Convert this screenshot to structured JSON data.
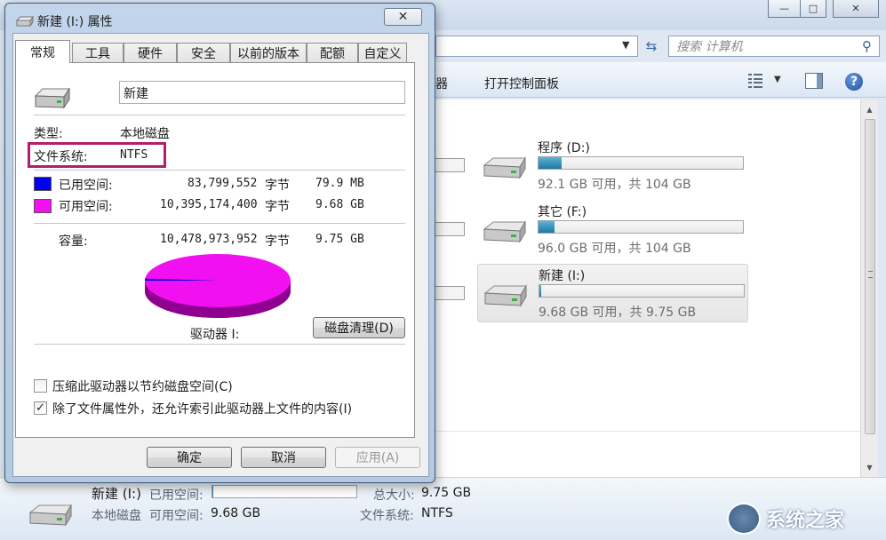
{
  "dialog": {
    "title": "新建 (I:) 属性",
    "close_glyph": "✕",
    "tabs": [
      {
        "label": "常规",
        "active": true
      },
      {
        "label": "工具"
      },
      {
        "label": "硬件"
      },
      {
        "label": "安全"
      },
      {
        "label": "以前的版本"
      },
      {
        "label": "配额"
      },
      {
        "label": "自定义"
      }
    ],
    "volume_name": "新建",
    "type_label": "类型:",
    "type_value": "本地磁盘",
    "fs_label": "文件系统:",
    "fs_value": "NTFS",
    "used": {
      "label": "已用空间:",
      "bytes": "83,799,552",
      "unit": "字节",
      "size": "79.9 MB",
      "color": "#0000f0"
    },
    "free": {
      "label": "可用空间:",
      "bytes": "10,395,174,400",
      "unit": "字节",
      "size": "9.68 GB",
      "color": "#f010f0"
    },
    "capacity": {
      "label": "容量:",
      "bytes": "10,478,973,952",
      "unit": "字节",
      "size": "9.75 GB"
    },
    "used_fraction": 0.008,
    "drive_caption": "驱动器 I:",
    "cleanup_button": "磁盘清理(D)",
    "compress": {
      "label": "压缩此驱动器以节约磁盘空间(C)",
      "checked": false
    },
    "index": {
      "label": "除了文件属性外，还允许索引此驱动器上文件的内容(I)",
      "checked": true
    },
    "ok_button": "确定",
    "cancel_button": "取消",
    "apply_button": "应用(A)"
  },
  "explorer": {
    "search_placeholder": "搜索 计算机",
    "toolbar_fragment": "器",
    "control_panel": "打开控制面板",
    "window_controls": {
      "minimize": "—",
      "maximize": "□",
      "close": "✕"
    },
    "drives": [
      {
        "name": "程序 (D:)",
        "free_text": "92.1 GB 可用，共 104 GB",
        "used_fraction": 0.115
      },
      {
        "name": "其它 (F:)",
        "free_text": "96.0 GB 可用，共 104 GB",
        "used_fraction": 0.077
      },
      {
        "name": "新建 (I:)",
        "free_text": "9.68 GB 可用，共 9.75 GB",
        "used_fraction": 0.008,
        "selected": true
      }
    ]
  },
  "details": {
    "name": "新建 (I:)",
    "used_label": "已用空间:",
    "used_fraction": 0.008,
    "type": "本地磁盘",
    "free_label": "可用空间:",
    "free_value": "9.68 GB",
    "total_label": "总大小:",
    "total_value": "9.75 GB",
    "fs_label": "文件系统:",
    "fs_value": "NTFS"
  },
  "watermark": {
    "text": "系统之家"
  }
}
